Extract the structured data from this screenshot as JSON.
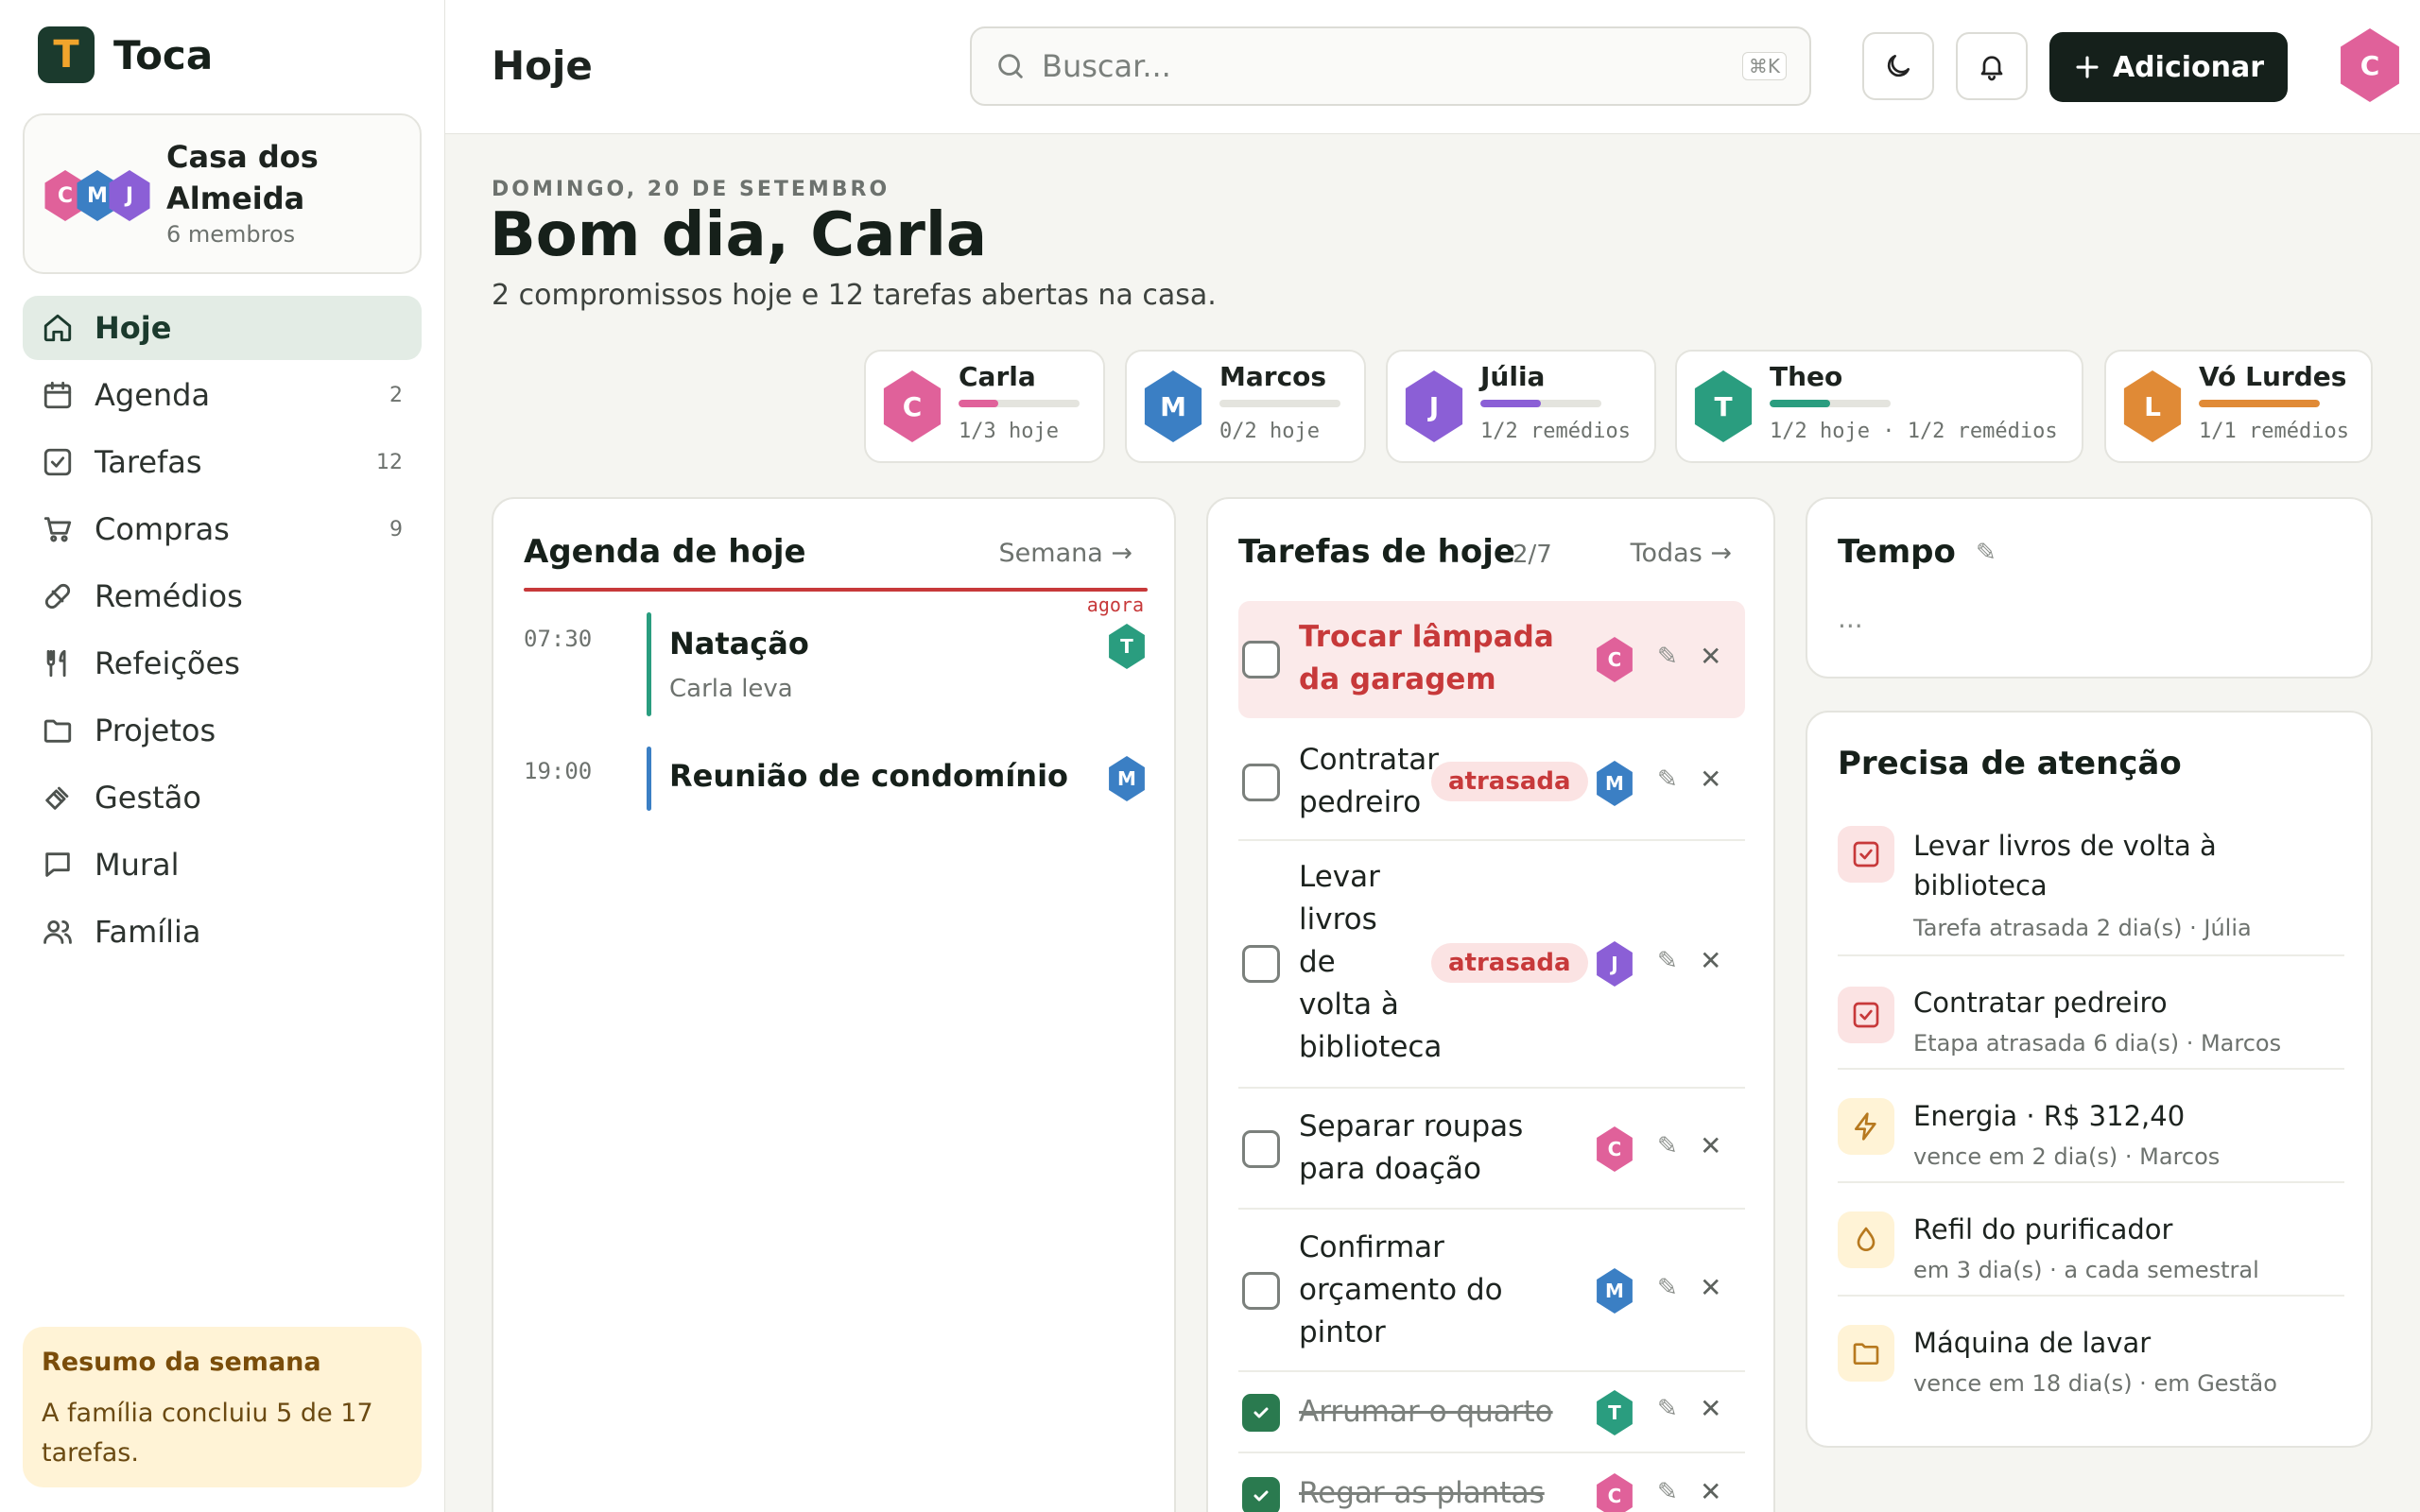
{
  "app": {
    "name": "Toca",
    "logo_letter": "T"
  },
  "household": {
    "name": "Casa dos Almeida",
    "members_label": "6 membros",
    "avatars": [
      "C",
      "M",
      "J"
    ]
  },
  "nav": [
    {
      "label": "Hoje",
      "count": "",
      "icon": "home-icon",
      "active": true
    },
    {
      "label": "Agenda",
      "count": "2",
      "icon": "calendar-icon"
    },
    {
      "label": "Tarefas",
      "count": "12",
      "icon": "checkbox-icon"
    },
    {
      "label": "Compras",
      "count": "9",
      "icon": "cart-icon"
    },
    {
      "label": "Remédios",
      "count": "",
      "icon": "pill-icon"
    },
    {
      "label": "Refeições",
      "count": "",
      "icon": "utensils-icon"
    },
    {
      "label": "Projetos",
      "count": "",
      "icon": "folder-icon"
    },
    {
      "label": "Gestão",
      "count": "",
      "icon": "bills-icon"
    },
    {
      "label": "Mural",
      "count": "",
      "icon": "message-icon"
    },
    {
      "label": "Família",
      "count": "",
      "icon": "users-icon"
    }
  ],
  "weekly": {
    "title": "Resumo da semana",
    "text": "A família concluiu 5 de 17 tarefas."
  },
  "header": {
    "title": "Hoje",
    "search_placeholder": "Buscar...",
    "search_shortcut": "⌘K",
    "add_label": "Adicionar",
    "user_initial": "C"
  },
  "main": {
    "date": "DOMINGO, 20 DE SETEMBRO",
    "greeting": "Bom dia, Carla",
    "subtitle": "2 compromissos hoje e 12 tarefas abertas na casa."
  },
  "members": [
    {
      "initial": "C",
      "name": "Carla",
      "stat": "1/3 hoje",
      "progress": 0.33,
      "color": "#e0619a"
    },
    {
      "initial": "M",
      "name": "Marcos",
      "stat": "0/2 hoje",
      "progress": 0,
      "color": "#3b7fc4"
    },
    {
      "initial": "J",
      "name": "Júlia",
      "stat": "1/2 remédios",
      "progress": 0.5,
      "color": "#8b5fd6"
    },
    {
      "initial": "T",
      "name": "Theo",
      "stat": "1/2 hoje · 1/2 remédios",
      "progress": 0.5,
      "color": "#2a9d7f"
    },
    {
      "initial": "L",
      "name": "Vó Lurdes",
      "stat": "1/1 remédios",
      "progress": 1,
      "color": "#e08a36"
    }
  ],
  "agenda": {
    "title": "Agenda de hoje",
    "link": "Semana →",
    "now_label": "agora",
    "events": [
      {
        "time": "07:30",
        "title": "Natação",
        "subtitle": "Carla leva",
        "assignee": "T",
        "color": "#2a9d7f"
      },
      {
        "time": "19:00",
        "title": "Reunião de condomínio",
        "subtitle": "",
        "assignee": "M",
        "color": "#3b7fc4"
      }
    ]
  },
  "tasks": {
    "title": "Tarefas de hoje",
    "count": "2/7",
    "link": "Todas →",
    "items": [
      {
        "text": "Trocar lâmpada da garagem",
        "assignee": "C",
        "color": "#e0619a",
        "highlight": true,
        "badge": "",
        "done": false
      },
      {
        "text": "Contratar pedreiro",
        "assignee": "M",
        "color": "#3b7fc4",
        "badge": "atrasada",
        "done": false
      },
      {
        "text": "Levar livros de volta à biblioteca",
        "assignee": "J",
        "color": "#8b5fd6",
        "badge": "atrasada",
        "done": false
      },
      {
        "text": "Separar roupas para doação",
        "assignee": "C",
        "color": "#e0619a",
        "badge": "",
        "done": false
      },
      {
        "text": "Confirmar orçamento do pintor",
        "assignee": "M",
        "color": "#3b7fc4",
        "badge": "",
        "done": false
      },
      {
        "text": "Arrumar o quarto",
        "assignee": "T",
        "color": "#2a9d7f",
        "badge": "",
        "done": true
      },
      {
        "text": "Regar as plantas",
        "assignee": "C",
        "color": "#e0619a",
        "badge": "",
        "done": true
      }
    ],
    "edit_glyph": "✎",
    "close_glyph": "✕"
  },
  "weather": {
    "title": "Tempo",
    "value": "..."
  },
  "attention": {
    "title": "Precisa de atenção",
    "items": [
      {
        "title": "Levar livros de volta à biblioteca",
        "subtitle": "Tarefa atrasada 2 dia(s) · Júlia",
        "icon": "checkbox-icon",
        "tone": "red"
      },
      {
        "title": "Contratar pedreiro",
        "subtitle": "Etapa atrasada 6 dia(s) · Marcos",
        "icon": "checkbox-icon",
        "tone": "red"
      },
      {
        "title": "Energia · R$ 312,40",
        "subtitle": "vence em 2 dia(s) · Marcos",
        "icon": "bolt-icon",
        "tone": "amber"
      },
      {
        "title": "Refil do purificador",
        "subtitle": "em 3 dia(s) · a cada semestral",
        "icon": "drop-icon",
        "tone": "amber"
      },
      {
        "title": "Máquina de lavar",
        "subtitle": "vence em 18 dia(s) · em Gestão",
        "icon": "folder-icon",
        "tone": "amber"
      }
    ]
  },
  "colors": {
    "brand": "#1b3a2d",
    "accent_amber": "#f1a42c",
    "danger": "#c7393a",
    "done": "#2a7a4f"
  }
}
